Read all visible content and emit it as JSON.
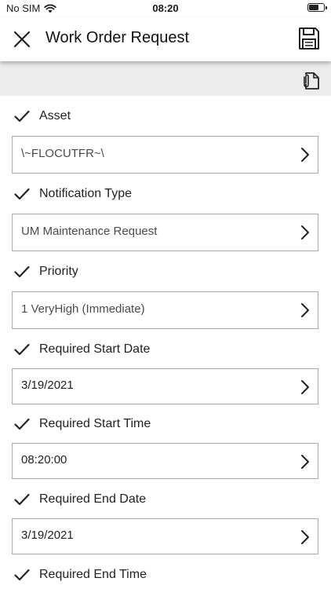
{
  "status_bar": {
    "carrier": "No SIM",
    "time": "08:20"
  },
  "header": {
    "title": "Work Order Request",
    "close_icon": "close-icon",
    "save_icon": "save-icon"
  },
  "toolbar": {
    "attach_icon": "attachment-icon"
  },
  "fields": [
    {
      "label": "Asset",
      "value": "\\~FLOCUTFR~\\"
    },
    {
      "label": "Notification Type",
      "value": "UM Maintenance Request"
    },
    {
      "label": "Priority",
      "value": "1 VeryHigh (Immediate)"
    },
    {
      "label": "Required Start Date",
      "value": "3/19/2021"
    },
    {
      "label": "Required Start Time",
      "value": "08:20:00"
    },
    {
      "label": "Required End Date",
      "value": "3/19/2021"
    },
    {
      "label": "Required End Time",
      "value": ""
    }
  ]
}
